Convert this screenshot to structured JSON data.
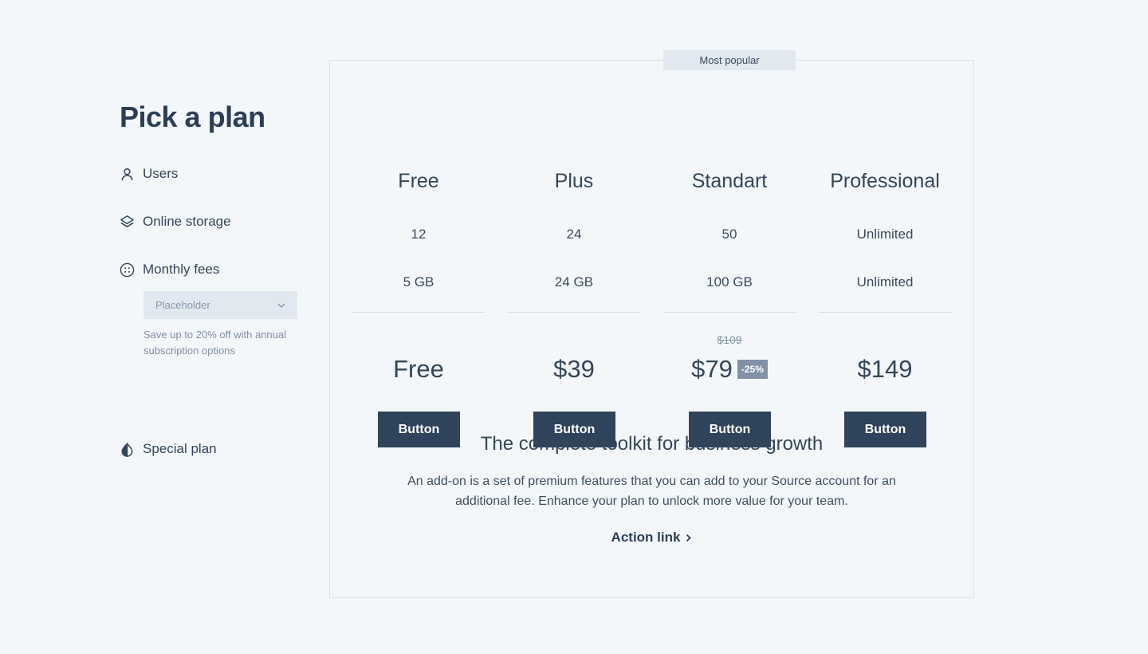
{
  "page_title": "Pick a plan",
  "rows": {
    "users": "Users",
    "storage": "Online storage",
    "fees": "Monthly fees",
    "special": "Special plan"
  },
  "billing_select": {
    "placeholder": "Placeholder",
    "hint": "Save up to 20% off with annual subscription options"
  },
  "popular_badge": "Most popular",
  "plans": [
    {
      "name": "Free",
      "users": "12",
      "storage": "5 GB",
      "old_price": "",
      "price": "Free",
      "discount": "",
      "button": "Button"
    },
    {
      "name": "Plus",
      "users": "24",
      "storage": "24 GB",
      "old_price": "",
      "price": "$39",
      "discount": "",
      "button": "Button"
    },
    {
      "name": "Standart",
      "users": "50",
      "storage": "100 GB",
      "old_price": "$109",
      "price": "$79",
      "discount": "-25%",
      "button": "Button"
    },
    {
      "name": "Professional",
      "users": "Unlimited",
      "storage": "Unlimited",
      "old_price": "",
      "price": "$149",
      "discount": "",
      "button": "Button"
    }
  ],
  "promo": {
    "title": "The complete toolkit for business growth",
    "text": "An add-on is a set of premium features that you can add to your Source account for an additional fee. Enhance your plan to unlock more value for your team.",
    "action_link": "Action link"
  },
  "colors": {
    "background": "#f4f7fa",
    "primary": "#2f435a",
    "badge_bg": "#e1e8ef",
    "discount_bg": "#8192a6"
  },
  "icons": {
    "users": "user-icon",
    "storage": "layers-icon",
    "fees": "coin-icon",
    "special": "contrast-icon",
    "select": "chevron-down-icon",
    "action_link": "chevron-right-icon"
  }
}
